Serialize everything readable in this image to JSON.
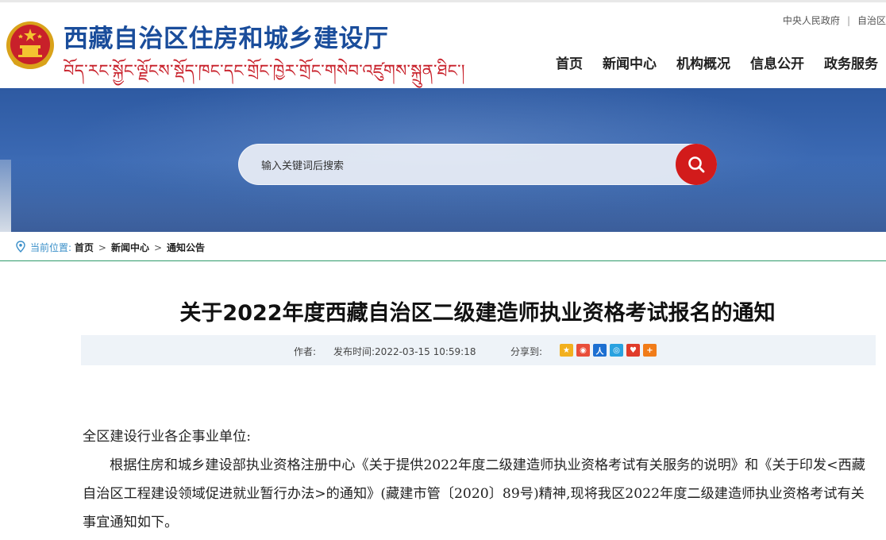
{
  "site": {
    "title": "西藏自治区住房和城乡建设厅",
    "subtitle": "བོད་རང་སྐྱོང་ལྗོངས་སྡོད་ཁང་དང་གྲོང་ཁྱེར་གྲོང་གསེབ་འཛུགས་སྐྲུན་ཐིང་།"
  },
  "toplinks": [
    "中央人民政府",
    "自治区"
  ],
  "nav": [
    "首页",
    "新闻中心",
    "机构概况",
    "信息公开",
    "政务服务"
  ],
  "search": {
    "placeholder": "输入关键词后搜索"
  },
  "breadcrumb": {
    "label": "当前位置:",
    "items": [
      "首页",
      "新闻中心",
      "通知公告"
    ]
  },
  "article": {
    "title": "关于2022年度西藏自治区二级建造师执业资格考试报名的通知",
    "author_label": "作者:",
    "publish_label": "发布时间:",
    "publish_time": "2022-03-15 10:59:18",
    "share_label": "分享到:",
    "share_icons": [
      "qzone-icon",
      "weibo-icon",
      "renren-icon",
      "tencent-weibo-icon",
      "kaixin-icon",
      "more-share-icon"
    ],
    "greeting": "全区建设行业各企事业单位:",
    "paragraph1": "根据住房和城乡建设部执业资格注册中心《关于提供2022年度二级建造师执业资格考试有关服务的说明》和《关于印发<西藏自治区工程建设领域促进就业暂行办法>的通知》(藏建市管〔2020〕89号)精神,现将我区2022年度二级建造师执业资格考试有关事宜通知如下。"
  },
  "colors": {
    "brand_blue": "#1a4d9b",
    "brand_red": "#c8202a",
    "search_button": "#d21b1b",
    "breadcrumb_line": "#2e9a6a"
  }
}
